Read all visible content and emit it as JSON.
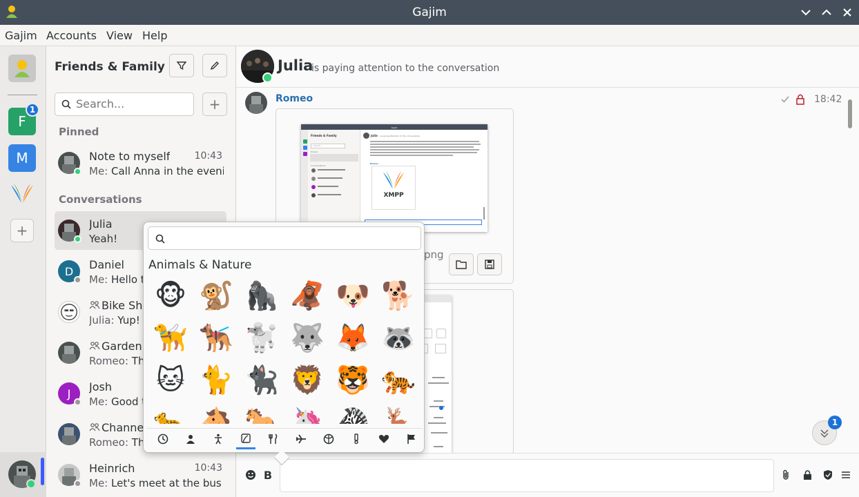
{
  "window": {
    "title": "Gajim"
  },
  "menu": [
    "Gajim",
    "Accounts",
    "View",
    "Help"
  ],
  "rail": {
    "workspaces": [
      {
        "letter": "F",
        "color": "#26a269",
        "badge": "1"
      },
      {
        "letter": "M",
        "color": "#3584e4"
      }
    ],
    "add_label": "+"
  },
  "sidebar": {
    "workspace_title": "Friends & Family",
    "search_placeholder": "Search...",
    "add_label": "+",
    "pinned_label": "Pinned",
    "conversations_label": "Conversations",
    "pinned": [
      {
        "name": "Note to myself",
        "time": "10:43",
        "sender": "Me:",
        "message": "Call Anna in the evening",
        "status": "#33d17a"
      }
    ],
    "conversations": [
      {
        "name": "Julia",
        "time": "",
        "sender": "",
        "message": "Yeah!",
        "avatar": "",
        "avatar_color": "#3a2a2a",
        "status": "#33d17a",
        "group": false,
        "selected": true
      },
      {
        "name": "Daniel",
        "time": "",
        "sender": "Me:",
        "message": "Hello th",
        "avatar": "D",
        "avatar_color": "#1c6f8f",
        "status": "#9a9996",
        "group": false
      },
      {
        "name": "Bike She",
        "time": "",
        "sender": "Julia:",
        "message": "Yup!",
        "avatar": "",
        "avatar_color": "#ffffff",
        "status": "",
        "group": true
      },
      {
        "name": "Gardeni",
        "time": "",
        "sender": "Romeo:",
        "message": "Tha",
        "avatar": "",
        "avatar_color": "#4a5050",
        "status": "",
        "group": true
      },
      {
        "name": "Josh",
        "time": "",
        "sender": "Me:",
        "message": "Good th",
        "avatar": "J",
        "avatar_color": "#9c1fc1",
        "status": "#9a9996",
        "group": false
      },
      {
        "name": "Channe",
        "time": "",
        "sender": "Romeo:",
        "message": "Tha",
        "avatar": "",
        "avatar_color": "#3d5170",
        "status": "",
        "group": true
      },
      {
        "name": "Heinrich",
        "time": "10:43",
        "sender": "Me:",
        "message": "Let's meet at the bus s...",
        "avatar": "",
        "avatar_color": "#c8c8c8",
        "status": "#9a9996",
        "group": false
      }
    ]
  },
  "chat": {
    "contact_name": "Julia",
    "contact_status": "is paying attention to the conversation",
    "message": {
      "sender": "Romeo",
      "time": "18:42",
      "file_suffix": "png"
    },
    "scroll_badge": "1"
  },
  "emoji_picker": {
    "category": "Animals & Nature",
    "emojis": [
      "🐵",
      "🐒",
      "🦍",
      "🦧",
      "🐶",
      "🐕",
      "🦮",
      "🐕‍🦺",
      "🐩",
      "🐺",
      "🦊",
      "🦝",
      "🐱",
      "🐈",
      "🐈‍⬛",
      "🦁",
      "🐯",
      "🐅",
      "🐆",
      "🐴",
      "🐎",
      "🦄",
      "🦓",
      "🦌"
    ],
    "tabs": [
      "recent-icon",
      "people-icon",
      "activity-icon",
      "nature-icon",
      "food-icon",
      "travel-icon",
      "objects-icon",
      "symbols-icon",
      "heart-icon",
      "flags-icon"
    ],
    "active_tab": 3
  },
  "screenshot_inside": {
    "app_title": "Gajim",
    "workspace": "Friends & Family",
    "search": "Search...",
    "pinned": "Pinned",
    "conversations": "Conversations",
    "contact": "Julia",
    "status": "is paying attention to the conversation",
    "sender": "Romeo",
    "logo_text": "XMPP"
  }
}
